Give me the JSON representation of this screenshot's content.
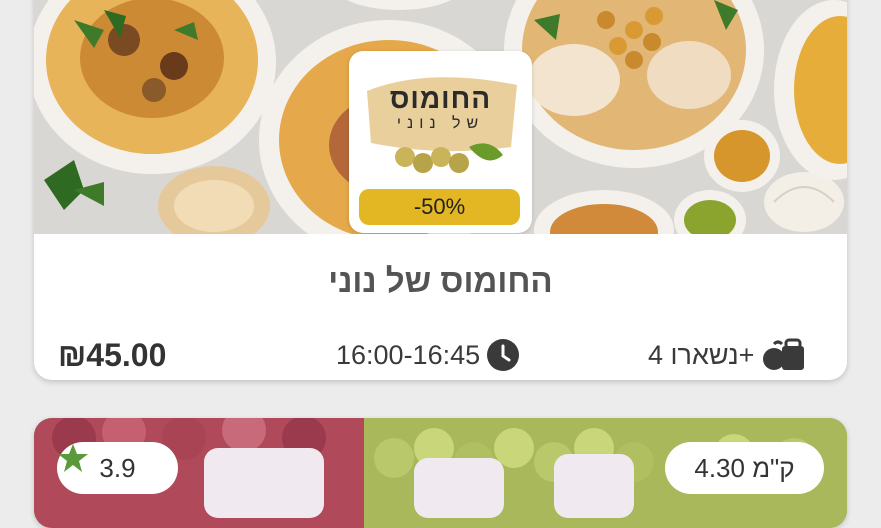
{
  "offers": [
    {
      "logo": {
        "title": "החומוס",
        "subtitle": "של נוני"
      },
      "discount": "-50%",
      "store_name": "החומוס של נוני",
      "price": "₪45.00",
      "pickup_time": "16:00-16:45",
      "remaining": "נשארו 4+",
      "icons": {
        "time": "clock-icon",
        "remaining": "shopping-bag-icon"
      }
    },
    {
      "rating": "3.9",
      "weight": "4.30 ק\"מ",
      "icons": {
        "rating": "star-icon"
      }
    }
  ],
  "colors": {
    "discount_badge": "#e3b724",
    "star": "#5a9a3a",
    "text_dark": "#333333",
    "store_name": "#545454"
  }
}
